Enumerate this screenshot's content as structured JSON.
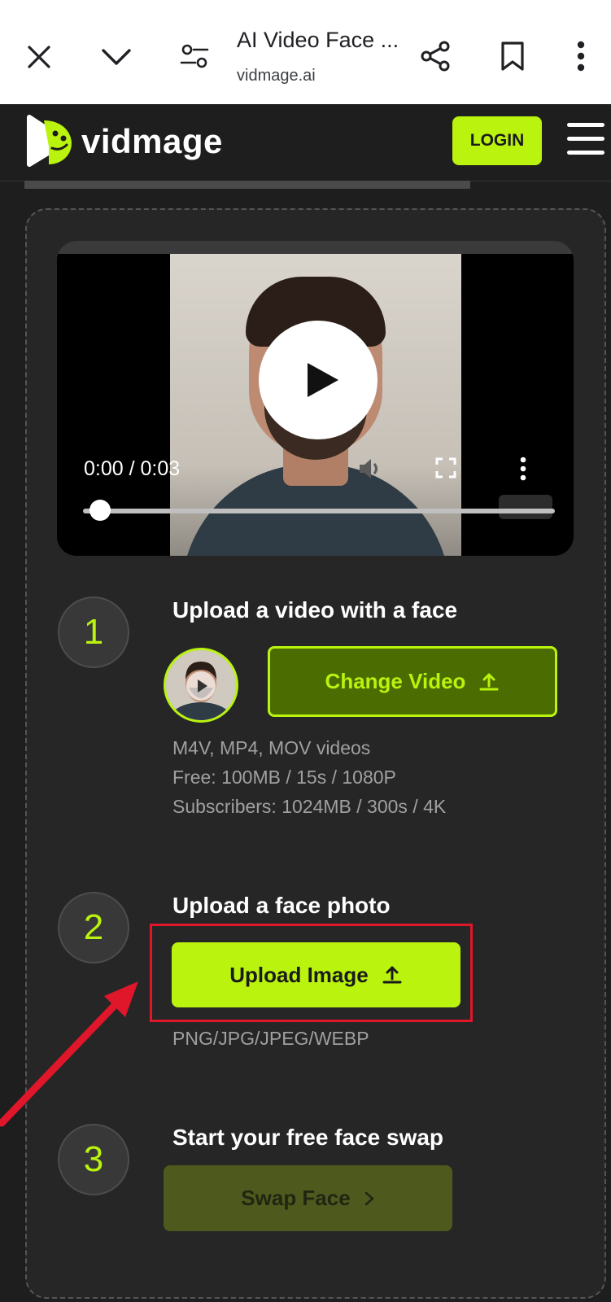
{
  "browser": {
    "tab_title": "AI Video Face ...",
    "host": "vidmage.ai"
  },
  "header": {
    "logo_text": "vidmage",
    "login_label": "LOGIN"
  },
  "video": {
    "time": "0:00 / 0:03",
    "progress": 0.0
  },
  "steps": [
    {
      "number": "1",
      "title": "Upload a video with a face",
      "button_label": "Change Video",
      "notes": [
        "M4V, MP4, MOV videos",
        "Free: 100MB / 15s / 1080P",
        "Subscribers: 1024MB / 300s / 4K"
      ]
    },
    {
      "number": "2",
      "title": "Upload a face photo",
      "button_label": "Upload Image",
      "formats": "PNG/JPG/JPEG/WEBP"
    },
    {
      "number": "3",
      "title": "Start your free face swap",
      "button_label": "Swap Face"
    }
  ],
  "colors": {
    "accent": "#b9f30e",
    "dark_green": "#4b6c00",
    "highlight_red": "#e0162b"
  }
}
